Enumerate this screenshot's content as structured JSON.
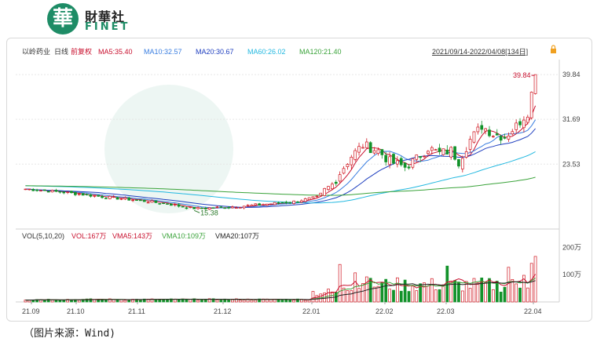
{
  "brand": {
    "logo_char": "華",
    "name_cn": "財華社",
    "name_en": "FINET"
  },
  "source_caption": "（图片来源：Wind)",
  "chart_data": [
    {
      "type": "candlestick",
      "stock": "以岭药业",
      "period": "日线",
      "adjust": "前复权",
      "ma_legend": [
        {
          "name": "MA5:35.40",
          "color": "#c8102e"
        },
        {
          "name": "MA10:32.57",
          "color": "#3a7ee0"
        },
        {
          "name": "MA20:30.67",
          "color": "#1f3fbf"
        },
        {
          "name": "MA60:26.02",
          "color": "#22b8e0"
        },
        {
          "name": "MA120:21.40",
          "color": "#3aa33a"
        }
      ],
      "date_range": "2021/09/14-2022/04/08[134日]",
      "y_ticks": [
        "39.84",
        "31.69",
        "23.53"
      ],
      "y_range": [
        12,
        42
      ],
      "high_label": "39.84",
      "low_label": "15.38",
      "x_ticks": [
        "21.09",
        "21.10",
        "21.11",
        "21.12",
        "22.01",
        "22.02",
        "22.03",
        "22.04"
      ],
      "grid": true,
      "anchors": [
        [
          0,
          19.0
        ],
        [
          10,
          18.4
        ],
        [
          20,
          17.6
        ],
        [
          30,
          16.9
        ],
        [
          38,
          16.2
        ],
        [
          44,
          15.38
        ],
        [
          55,
          15.8
        ],
        [
          62,
          16.2
        ],
        [
          70,
          16.7
        ],
        [
          76,
          17.5
        ],
        [
          80,
          19.8
        ],
        [
          83,
          23.0
        ],
        [
          85,
          25.0
        ],
        [
          88,
          27.0
        ],
        [
          92,
          26.0
        ],
        [
          95,
          24.0
        ],
        [
          99,
          23.0
        ],
        [
          102,
          24.5
        ],
        [
          105,
          26.5
        ],
        [
          108,
          25.5
        ],
        [
          111,
          26.0
        ],
        [
          113,
          24.0
        ],
        [
          116,
          28.0
        ],
        [
          119,
          30.5
        ],
        [
          122,
          29.0
        ],
        [
          125,
          28.5
        ],
        [
          128,
          30.5
        ],
        [
          131,
          33.0
        ],
        [
          133,
          39.84
        ]
      ]
    },
    {
      "type": "bar",
      "legend": [
        {
          "name": "VOL(5,10,20)",
          "color": "#333333"
        },
        {
          "name": "VOL:167万",
          "color": "#c8102e"
        },
        {
          "name": "VMA5:143万",
          "color": "#c8102e"
        },
        {
          "name": "VMA10:109万",
          "color": "#3aa33a"
        },
        {
          "name": "VMA20:107万",
          "color": "#222222"
        }
      ],
      "y_ticks": [
        "200万",
        "100万"
      ],
      "y_range": [
        0,
        210
      ]
    }
  ]
}
